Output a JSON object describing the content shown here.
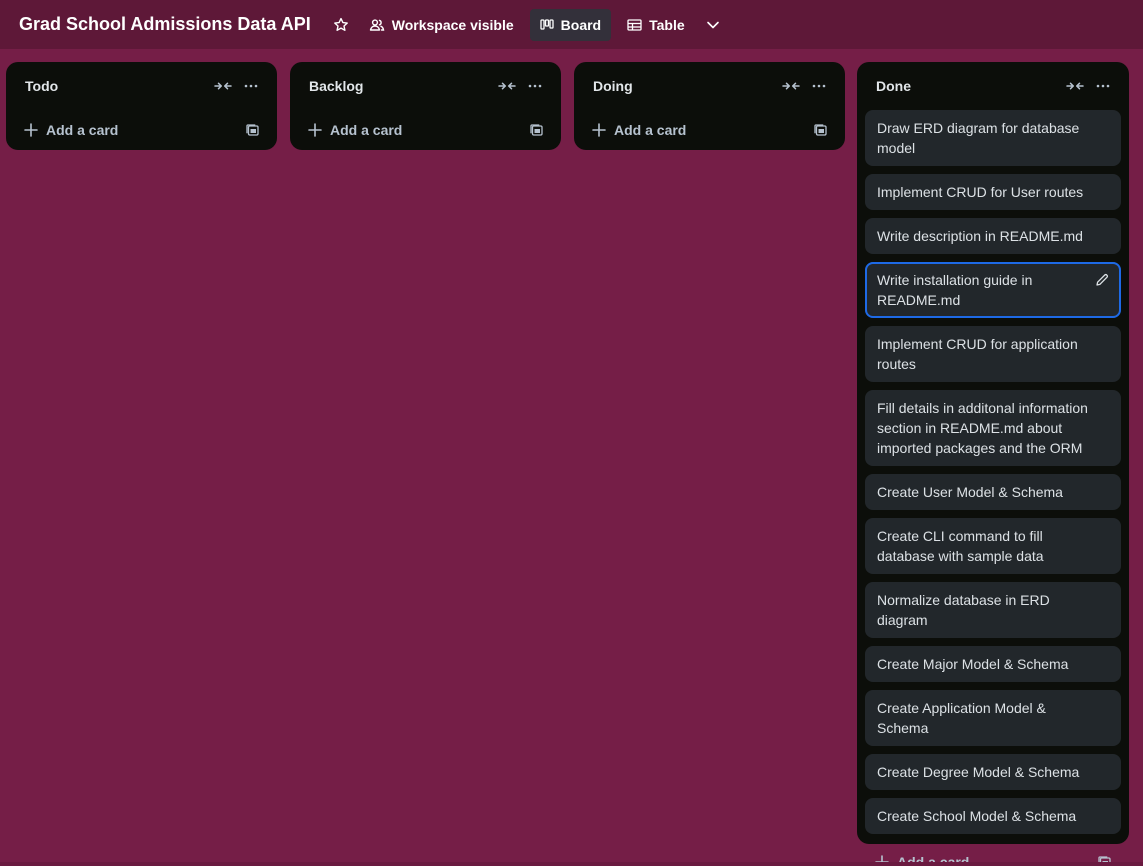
{
  "header": {
    "board_title": "Grad School Admissions Data API",
    "visibility_label": "Workspace visible",
    "board_view_label": "Board",
    "table_view_label": "Table"
  },
  "lists": [
    {
      "title": "Todo",
      "add_label": "Add a card",
      "cards": []
    },
    {
      "title": "Backlog",
      "add_label": "Add a card",
      "cards": []
    },
    {
      "title": "Doing",
      "add_label": "Add a card",
      "cards": []
    },
    {
      "title": "Done",
      "add_label": "Add a card",
      "cards": [
        "Draw ERD diagram for database model",
        "Implement CRUD for User routes",
        "Write description in README.md",
        "Write installation guide in README.md",
        "Implement CRUD for application routes",
        "Fill details in additonal information section in README.md about imported packages and the ORM",
        "Create User Model & Schema",
        "Create CLI command to fill database with sample data",
        "Normalize database in ERD diagram",
        "Create Major Model & Schema",
        "Create Application Model & Schema",
        "Create Degree Model & Schema",
        "Create School Model & Schema"
      ]
    }
  ],
  "colors": {
    "board_background": "#751e47",
    "header_background": "#5e1838",
    "list_background": "#0c0e0a",
    "card_background": "#22272b",
    "selected_card_border": "#1e6ae6"
  }
}
